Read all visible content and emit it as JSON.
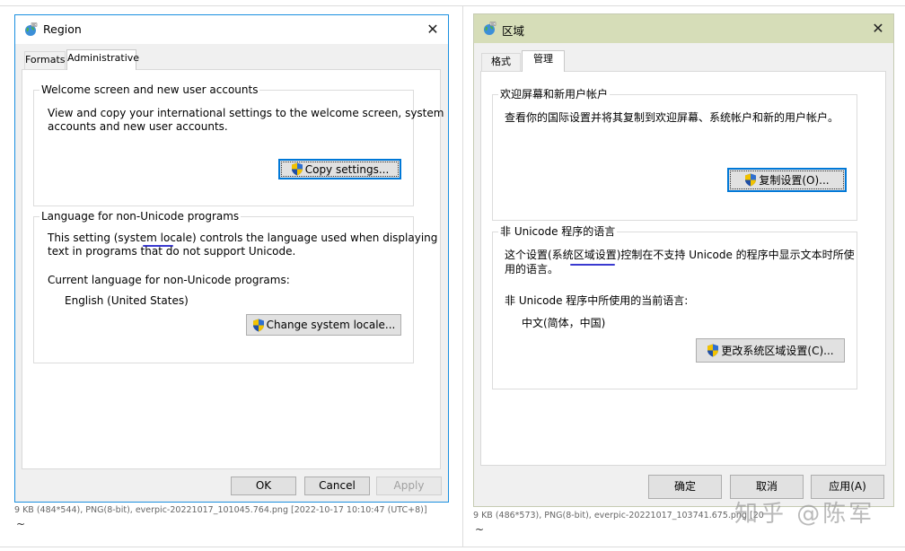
{
  "left": {
    "window_title": "Region",
    "close_glyph": "✕",
    "tabs": [
      "Formats",
      "Administrative"
    ],
    "welcome": {
      "title": "Welcome screen and new user accounts",
      "line1": "View and copy your international settings to the welcome screen, system",
      "line2": "accounts and new user accounts.",
      "button": "Copy settings..."
    },
    "nonunicode": {
      "title": "Language for non-Unicode programs",
      "line1_pre": "This setting (system ",
      "line1_locale": "locale",
      "line1_post": ") controls the language used when displaying",
      "line2": "text in programs that do not support Unicode.",
      "current_label": "Current language for non-Unicode programs:",
      "current_value": "English (United States)",
      "button": "Change system locale..."
    },
    "buttons": {
      "ok": "OK",
      "cancel": "Cancel",
      "apply": "Apply"
    },
    "caption": "9 KB (484*544), PNG(8-bit), everpic-20221017_101045.764.png [2022-10-17 10:10:47 (UTC+8)]",
    "tilde": "~"
  },
  "right": {
    "window_title": "区域",
    "close_glyph": "✕",
    "tabs": [
      "格式",
      "管理"
    ],
    "welcome": {
      "title": "欢迎屏幕和新用户帐户",
      "line1": "查看你的国际设置并将其复制到欢迎屏幕、系统帐户和新的用户帐户。",
      "button": "复制设置(O)..."
    },
    "nonunicode": {
      "title": "非 Unicode 程序的语言",
      "line1_pre": "这个设置(系统",
      "line1_locale": "区域设置",
      "line1_post": ")控制在不支持 Unicode 的程序中显示文本时所使",
      "line2": "用的语言。",
      "current_label": "非 Unicode 程序中所使用的当前语言:",
      "current_value": "中文(简体，中国)",
      "button": "更改系统区域设置(C)..."
    },
    "buttons": {
      "ok": "确定",
      "cancel": "取消",
      "apply": "应用(A)"
    },
    "caption": "9 KB (486*573), PNG(8-bit), everpic-20221017_103741.675.png [20",
    "tilde": "~"
  },
  "watermark": "知乎 @陈军",
  "colors": {
    "focus_border": "#0078d7",
    "locale_underline": "#3a3ad0",
    "dialog_bg": "#f0f0f0",
    "right_titlebar": "#d6ddb8"
  }
}
